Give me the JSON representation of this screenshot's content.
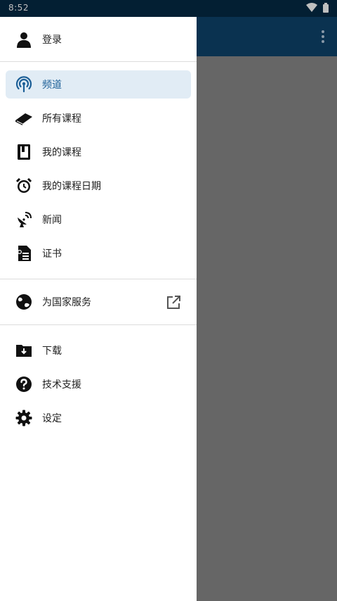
{
  "status_bar": {
    "time": "8:52"
  },
  "header": {
    "login_label": "登录"
  },
  "menu": {
    "channels": "频道",
    "all_courses": "所有课程",
    "my_courses": "我的课程",
    "course_dates": "我的课程日期",
    "news": "新闻",
    "certificates": "证书",
    "serve_country": "为国家服务",
    "downloads": "下载",
    "support": "技术支援",
    "settings": "设定"
  },
  "colors": {
    "accent": "#1c5f97",
    "active_bg": "#e1ecf5",
    "app_bar": "#0a3250",
    "status_bar": "#052a45",
    "scrim": "#666666"
  },
  "icons": {
    "login": "person-icon",
    "channels": "broadcast-icon",
    "all_courses": "book-icon",
    "my_courses": "notebook-icon",
    "course_dates": "alarm-clock-icon",
    "news": "satellite-dish-icon",
    "certificates": "certificate-icon",
    "serve_country": "globe-icon",
    "external": "external-link-icon",
    "downloads": "download-folder-icon",
    "support": "help-circle-icon",
    "settings": "gear-icon"
  }
}
